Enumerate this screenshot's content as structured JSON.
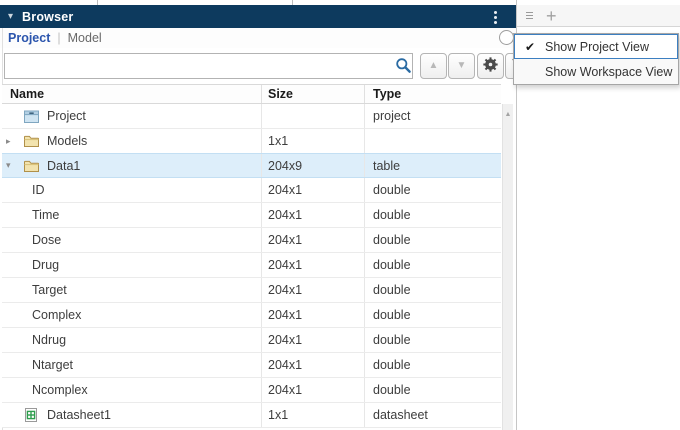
{
  "panel": {
    "title": "Browser"
  },
  "tabs": {
    "project": "Project",
    "separator": "|",
    "model": "Model"
  },
  "search": {
    "value": "",
    "placeholder": ""
  },
  "table": {
    "columns": {
      "name": "Name",
      "size": "Size",
      "type": "Type"
    },
    "rows": [
      {
        "name": "Project",
        "size": "",
        "type": "project",
        "icon": "project",
        "arrow": "none",
        "indent": 0,
        "selected": false
      },
      {
        "name": "Models",
        "size": "1x1",
        "type": "",
        "icon": "folder",
        "arrow": "collapsed",
        "indent": 0,
        "selected": false
      },
      {
        "name": "Data1",
        "size": "204x9",
        "type": "table",
        "icon": "folder",
        "arrow": "expanded",
        "indent": 0,
        "selected": true
      },
      {
        "name": "ID",
        "size": "204x1",
        "type": "double",
        "icon": "none",
        "arrow": "none",
        "indent": 1,
        "selected": false
      },
      {
        "name": "Time",
        "size": "204x1",
        "type": "double",
        "icon": "none",
        "arrow": "none",
        "indent": 1,
        "selected": false
      },
      {
        "name": "Dose",
        "size": "204x1",
        "type": "double",
        "icon": "none",
        "arrow": "none",
        "indent": 1,
        "selected": false
      },
      {
        "name": "Drug",
        "size": "204x1",
        "type": "double",
        "icon": "none",
        "arrow": "none",
        "indent": 1,
        "selected": false
      },
      {
        "name": "Target",
        "size": "204x1",
        "type": "double",
        "icon": "none",
        "arrow": "none",
        "indent": 1,
        "selected": false
      },
      {
        "name": "Complex",
        "size": "204x1",
        "type": "double",
        "icon": "none",
        "arrow": "none",
        "indent": 1,
        "selected": false
      },
      {
        "name": "Ndrug",
        "size": "204x1",
        "type": "double",
        "icon": "none",
        "arrow": "none",
        "indent": 1,
        "selected": false
      },
      {
        "name": "Ntarget",
        "size": "204x1",
        "type": "double",
        "icon": "none",
        "arrow": "none",
        "indent": 1,
        "selected": false
      },
      {
        "name": "Ncomplex",
        "size": "204x1",
        "type": "double",
        "icon": "none",
        "arrow": "none",
        "indent": 1,
        "selected": false
      },
      {
        "name": "Datasheet1",
        "size": "1x1",
        "type": "datasheet",
        "icon": "datasheet",
        "arrow": "none",
        "indent": 0,
        "selected": false
      }
    ]
  },
  "menu": {
    "items": [
      {
        "label": "Show Project View",
        "checked": true,
        "selected": true
      },
      {
        "label": "Show Workspace View",
        "checked": false,
        "selected": false
      }
    ]
  },
  "right_panel": {
    "add_tab_label": "+"
  },
  "icons": {
    "collapse": "▾",
    "collapsed": "▸",
    "expanded": "▾",
    "search_prev": "▲",
    "search_next": "▼",
    "scroll_up": "▲",
    "check": "✔"
  },
  "colors": {
    "header_navy": "#0d3a5e",
    "selected_row": "#ddeefa",
    "project_tab_blue": "#2b55ad",
    "menu_highlight_border": "#3c7fc1",
    "search_icon_blue": "#2a6ba3",
    "folder_yellow": "#f2e3ae",
    "datasheet_green": "#2f9e4e"
  }
}
